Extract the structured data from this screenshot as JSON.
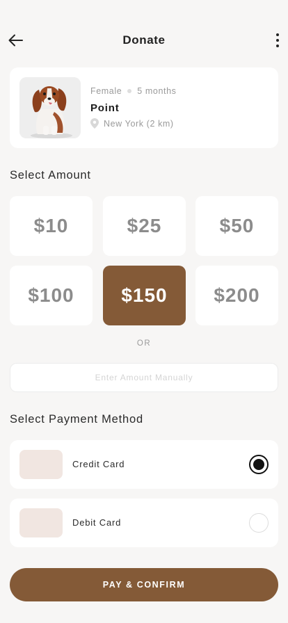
{
  "header": {
    "title": "Donate",
    "back_icon": "arrow-left-icon",
    "menu_icon": "more-vertical-icon"
  },
  "pet": {
    "gender": "Female",
    "age": "5 months",
    "name": "Point",
    "location": "New York (2 km)",
    "photo": "dog-photo"
  },
  "amount_section": {
    "label": "Select Amount",
    "options": [
      "$10",
      "$25",
      "$50",
      "$100",
      "$150",
      "$200"
    ],
    "selected": "$150",
    "or_label": "OR",
    "manual_placeholder": "Enter Amount Manually",
    "manual_value": ""
  },
  "payment_section": {
    "label": "Select Payment Method",
    "methods": [
      {
        "label": "Credit Card",
        "selected": true
      },
      {
        "label": "Debit Card",
        "selected": false
      }
    ]
  },
  "cta": {
    "label": "PAY & CONFIRM"
  },
  "colors": {
    "accent": "#845a37",
    "background": "#f7f6f5",
    "card": "#ffffff",
    "thumb": "#f1e6e1"
  }
}
